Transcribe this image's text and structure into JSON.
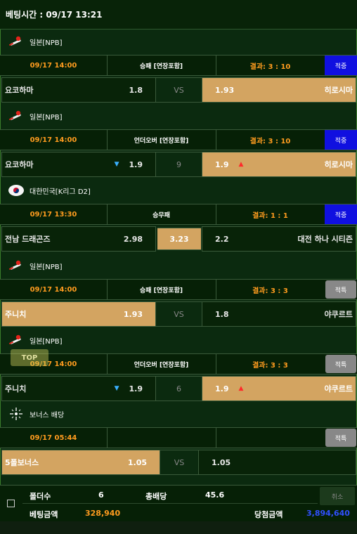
{
  "header": {
    "bet_time": "베팅시간 : 09/17 13:21"
  },
  "bets": [
    {
      "league": "일본[NPB]",
      "flag": "japan-baseball-icon",
      "date": "09/17 14:00",
      "market": "승패 [연장포함]",
      "result": "결과: 3 : 10",
      "status": "적중",
      "status_type": "hit",
      "home": "요코하마",
      "home_odds": "1.8",
      "mid": "VS",
      "away_odds": "1.93",
      "away": "히로시마",
      "selected": "away",
      "home_arrow": "",
      "away_arrow": ""
    },
    {
      "league": "일본[NPB]",
      "flag": "japan-baseball-icon",
      "date": "09/17 14:00",
      "market": "언더오버 [연장포함]",
      "result": "결과: 3 : 10",
      "status": "적중",
      "status_type": "hit",
      "home": "요코하마",
      "home_odds": "1.9",
      "mid": "9",
      "away_odds": "1.9",
      "away": "히로시마",
      "selected": "away",
      "home_arrow": "▼",
      "away_arrow": "▲"
    },
    {
      "league": "대한민국[K리그 D2]",
      "flag": "korea-flag-icon",
      "date": "09/17 13:30",
      "market": "승무패",
      "result": "결과: 1 : 1",
      "status": "적중",
      "status_type": "hit",
      "home": "전남 드래곤즈",
      "home_odds": "2.98",
      "mid": "3.23",
      "away_odds": "2.2",
      "away": "대전 하나 시티즌",
      "selected": "mid",
      "home_arrow": "",
      "away_arrow": ""
    },
    {
      "league": "일본[NPB]",
      "flag": "japan-baseball-icon",
      "date": "09/17 14:00",
      "market": "승패 [연장포함]",
      "result": "결과: 3 : 3",
      "status": "적특",
      "status_type": "special",
      "home": "주니치",
      "home_odds": "1.93",
      "mid": "VS",
      "away_odds": "1.8",
      "away": "야쿠르트",
      "selected": "home",
      "home_arrow": "",
      "away_arrow": ""
    },
    {
      "league": "일본[NPB]",
      "flag": "japan-baseball-icon",
      "date": "09/17 14:00",
      "market": "언더오버 [연장포함]",
      "result": "결과: 3 : 3",
      "status": "적특",
      "status_type": "special",
      "home": "주니치",
      "home_odds": "1.9",
      "mid": "6",
      "away_odds": "1.9",
      "away": "야쿠르트",
      "selected": "away",
      "home_arrow": "▼",
      "away_arrow": "▲"
    },
    {
      "league": "보너스 배당",
      "flag": "bonus-sparkle-icon",
      "date": "09/17 05:44",
      "market": "",
      "result": "",
      "status": "적특",
      "status_type": "special",
      "home": "5폴보너스",
      "home_odds": "1.05",
      "mid": "VS",
      "away_odds": "1.05",
      "away": "",
      "selected": "home",
      "home_arrow": "",
      "away_arrow": ""
    }
  ],
  "top_button": "TOP",
  "summary": {
    "folder_label": "폴더수",
    "folder_value": "6",
    "total_odds_label": "총배당",
    "total_odds_value": "45.6",
    "bet_amount_label": "베팅금액",
    "bet_amount_value": "328,940",
    "win_amount_label": "당첨금액",
    "win_amount_value": "3,894,640",
    "cancel_label": "취소"
  }
}
